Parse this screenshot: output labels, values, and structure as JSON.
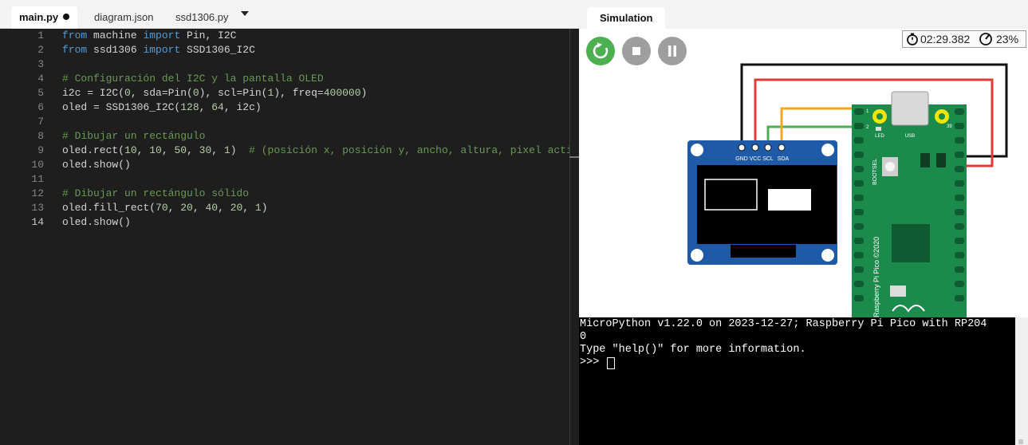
{
  "editor": {
    "tabs": [
      {
        "label": "main.py",
        "modified": true
      },
      {
        "label": "diagram.json",
        "modified": false
      },
      {
        "label": "ssd1306.py",
        "modified": false
      }
    ],
    "lines": [
      {
        "n": "1",
        "tokens": [
          [
            "kw",
            "from"
          ],
          [
            "t",
            " machine "
          ],
          [
            "kw",
            "import"
          ],
          [
            "t",
            " Pin, I2C"
          ]
        ]
      },
      {
        "n": "2",
        "tokens": [
          [
            "kw",
            "from"
          ],
          [
            "t",
            " ssd1306 "
          ],
          [
            "kw",
            "import"
          ],
          [
            "t",
            " SSD1306_I2C"
          ]
        ]
      },
      {
        "n": "3",
        "tokens": []
      },
      {
        "n": "4",
        "tokens": [
          [
            "cm",
            "# Configuración del I2C y la pantalla OLED"
          ]
        ]
      },
      {
        "n": "5",
        "tokens": [
          [
            "t",
            "i2c = I2C("
          ],
          [
            "num",
            "0"
          ],
          [
            "t",
            ", sda=Pin("
          ],
          [
            "num",
            "0"
          ],
          [
            "t",
            "), scl=Pin("
          ],
          [
            "num",
            "1"
          ],
          [
            "t",
            "), freq="
          ],
          [
            "num",
            "400000"
          ],
          [
            "t",
            ")"
          ]
        ]
      },
      {
        "n": "6",
        "tokens": [
          [
            "t",
            "oled = SSD1306_I2C("
          ],
          [
            "num",
            "128"
          ],
          [
            "t",
            ", "
          ],
          [
            "num",
            "64"
          ],
          [
            "t",
            ", i2c)"
          ]
        ]
      },
      {
        "n": "7",
        "tokens": []
      },
      {
        "n": "8",
        "tokens": [
          [
            "cm",
            "# Dibujar un rectángulo"
          ]
        ]
      },
      {
        "n": "9",
        "tokens": [
          [
            "t",
            "oled.rect("
          ],
          [
            "num",
            "10"
          ],
          [
            "t",
            ", "
          ],
          [
            "num",
            "10"
          ],
          [
            "t",
            ", "
          ],
          [
            "num",
            "50"
          ],
          [
            "t",
            ", "
          ],
          [
            "num",
            "30"
          ],
          [
            "t",
            ", "
          ],
          [
            "num",
            "1"
          ],
          [
            "t",
            ")  "
          ],
          [
            "cm",
            "# (posición x, posición y, ancho, altura, pixel activado)"
          ]
        ]
      },
      {
        "n": "10",
        "tokens": [
          [
            "t",
            "oled.show()"
          ]
        ]
      },
      {
        "n": "11",
        "tokens": []
      },
      {
        "n": "12",
        "tokens": [
          [
            "cm",
            "# Dibujar un rectángulo sólido"
          ]
        ]
      },
      {
        "n": "13",
        "tokens": [
          [
            "t",
            "oled.fill_rect("
          ],
          [
            "num",
            "70"
          ],
          [
            "t",
            ", "
          ],
          [
            "num",
            "20"
          ],
          [
            "t",
            ", "
          ],
          [
            "num",
            "40"
          ],
          [
            "t",
            ", "
          ],
          [
            "num",
            "20"
          ],
          [
            "t",
            ", "
          ],
          [
            "num",
            "1"
          ],
          [
            "t",
            ")"
          ]
        ]
      },
      {
        "n": "14",
        "tokens": [
          [
            "t",
            "oled.show()"
          ]
        ]
      }
    ],
    "current_line": "14"
  },
  "simulation": {
    "tab_label": "Simulation",
    "elapsed": "02:29.382",
    "speed": "23%",
    "oled_pins": [
      "GND",
      "VCC",
      "SCL",
      "SDA"
    ],
    "pico_labels": {
      "led": "LED",
      "usb": "USB",
      "bootsel": "BOOTSEL",
      "silkscreen": "Raspberry Pi Pico ©2020",
      "pin_1": "1",
      "pin_2": "2",
      "pin_39": "39"
    },
    "wire_colors": {
      "gnd": "#111111",
      "vcc": "#e53935",
      "scl": "#4caf50",
      "sda": "#f5a623"
    }
  },
  "terminal": {
    "lines": [
      "MicroPython v1.22.0 on 2023-12-27; Raspberry Pi Pico with RP204",
      "0",
      "Type \"help()\" for more information."
    ],
    "prompt": ">>> "
  }
}
